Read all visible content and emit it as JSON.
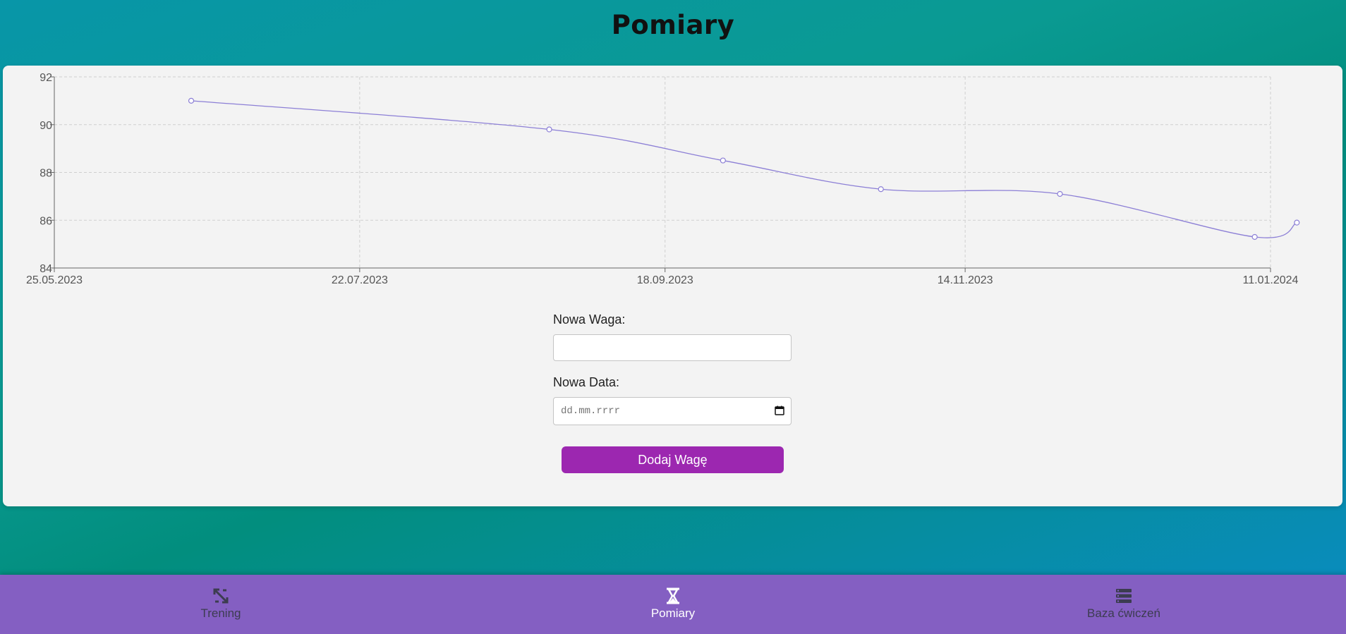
{
  "header": {
    "title": "Pomiary"
  },
  "chart_data": {
    "type": "line",
    "x": [
      "2023-06-20",
      "2023-08-27",
      "2023-09-29",
      "2023-10-29",
      "2023-12-02",
      "2024-01-08",
      "2024-01-16"
    ],
    "series": [
      {
        "values": [
          91.0,
          89.8,
          88.5,
          87.3,
          87.1,
          85.3,
          85.9
        ]
      }
    ],
    "x_ticks": [
      "25.05.2023",
      "22.07.2023",
      "18.09.2023",
      "14.11.2023",
      "11.01.2024"
    ],
    "y_ticks": [
      84,
      86,
      88,
      90,
      92
    ],
    "xlim": [
      "2023-05-25",
      "2024-01-11"
    ],
    "ylim": [
      84,
      92
    ],
    "grid": true,
    "line_color": "#8c7fd6"
  },
  "form": {
    "weight_label": "Nowa Waga:",
    "weight_value": "",
    "date_label": "Nowa Data:",
    "date_placeholder": "dd.mm.rrrr",
    "submit_label": "Dodaj Wagę"
  },
  "nav": {
    "items": [
      {
        "label": "Trening",
        "icon": "expand-arrows-icon",
        "active": false
      },
      {
        "label": "Pomiary",
        "icon": "hourglass-icon",
        "active": true
      },
      {
        "label": "Baza ćwiczeń",
        "icon": "list-icon",
        "active": false
      }
    ]
  },
  "colors": {
    "accent": "#9c27b0",
    "nav_bg": "#845fc2",
    "card_bg": "#f3f3f3"
  }
}
